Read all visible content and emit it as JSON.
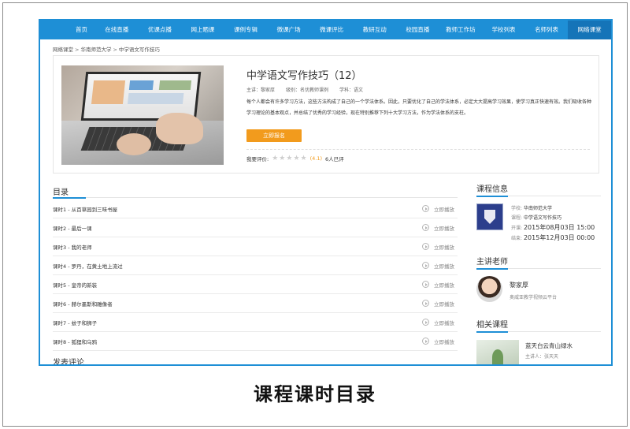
{
  "nav": {
    "items": [
      "首页",
      "在线直播",
      "优课点播",
      "网上晒课",
      "课例专辑",
      "微课广场",
      "微课评比",
      "教研互动",
      "校园直播",
      "教师工作坊",
      "学校列表",
      "名师列表",
      "网络课堂"
    ],
    "active_index": 12
  },
  "breadcrumb": [
    "网络课堂",
    "华南师范大学",
    "中学语文写作技巧"
  ],
  "breadcrumb_sep": ">",
  "course": {
    "title": "中学语文写作技巧（12）",
    "teacher": "主讲：黎家厚",
    "level": "级别：名优教师课例",
    "subject": "学科：语文",
    "description": "每个人都会有许多学习方法，这些方法构成了自己的一个学法体系。因此，只要优化了自己的学法体系，必定大大提高学习效果，使学习真正快速有效。我们吸收各种学习理论的基本观点，并总结了优秀的学习经验，现在特别推荐下列十大学习方法，作为学法体系的支柱。",
    "enroll_label": "立即报名",
    "rating_label": "我要评价:",
    "rating_score": "(4.1)",
    "rating_count": "6人已评",
    "stars_filled": 0,
    "stars_total": 5
  },
  "toc": {
    "heading": "目录",
    "play_label": "立即播放",
    "lessons": [
      "课时1 - 从百草园到三味书屋",
      "课时2 - 最后一课",
      "课时3 - 我的老师",
      "课时4 - 罗丹，在黄土地上流过",
      "课时5 - 皇帝的新装",
      "课时6 - 赫尔墨斯和雕像者",
      "课时7 - 蚊子和狮子",
      "课时8 - 狐狸和乌鸦"
    ]
  },
  "comments": {
    "heading": "发表评论"
  },
  "sidebar": {
    "info_heading": "课程信息",
    "school_label": "学校:",
    "school_value": "华南师范大学",
    "course_label": "课程:",
    "course_value": "中学语文写作技巧",
    "start_label": "开课:",
    "start_value": "2015年08月03日 15:00",
    "end_label": "结束:",
    "end_value": "2015年12月03日 00:00",
    "teacher_heading": "主讲老师",
    "teacher_name": "黎家厚",
    "teacher_org": "奥威亚教学视频云平台",
    "related_heading": "相关课程",
    "related_title": "蓝天白云青山绿水",
    "related_teacher": "主讲人：张天天"
  },
  "caption": "课程课时目录",
  "colors": {
    "nav_bg": "#1e8fd6",
    "nav_active": "#1574b8",
    "accent_orange": "#f29b1d",
    "frame_blue": "#1e8fd6"
  }
}
